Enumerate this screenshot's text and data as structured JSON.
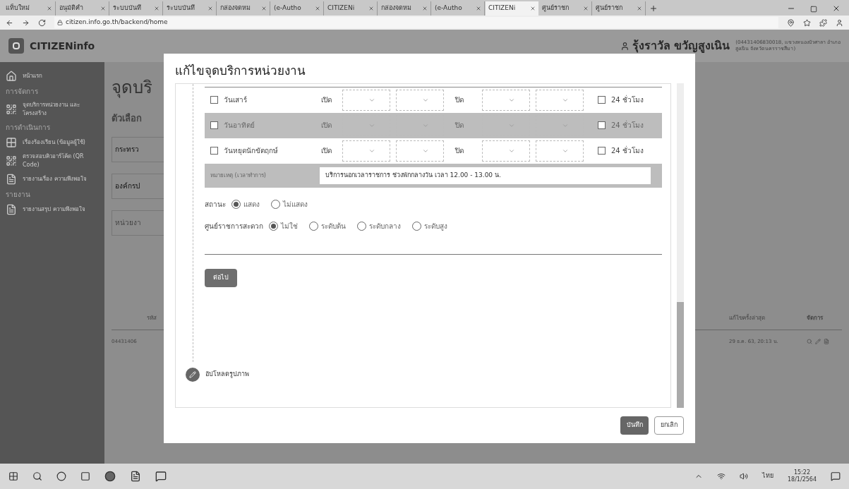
{
  "browser": {
    "tabs": [
      {
        "label": "แท็บใหม่",
        "selected": false
      },
      {
        "label": "อนุมัติคำ",
        "selected": false
      },
      {
        "label": "ระบบบันทึ",
        "selected": false
      },
      {
        "label": "ระบบบันทึ",
        "selected": false
      },
      {
        "label": "กล่องจดหม",
        "selected": false
      },
      {
        "label": "(e-Autho",
        "selected": false
      },
      {
        "label": "CITIZENi",
        "selected": false
      },
      {
        "label": "กล่องจดหม",
        "selected": false
      },
      {
        "label": "(e-Autho",
        "selected": false
      },
      {
        "label": "CITIZENi",
        "selected": true
      },
      {
        "label": "ศูนย์ราชก",
        "selected": false
      },
      {
        "label": "ศูนย์ราชก",
        "selected": false
      }
    ],
    "url": "citizen.info.go.th/backend/home"
  },
  "header": {
    "logo": "CITIZENinfo",
    "user_name": "รุ้งราวัล ขวัญสูงเนิน",
    "user_detail": [
      "(04431406830018, แขวงหนองบัวศาลา อำเภอ",
      "สูงเนิน จังหวัดนครราชสีมา)"
    ]
  },
  "sidebar": {
    "items": [
      {
        "kind": "link",
        "label": "หน้าแรก"
      },
      {
        "kind": "heading",
        "label": "การจัดการ"
      },
      {
        "kind": "link",
        "label": "จุดบริการหน่วยงาน และโครงสร้าง"
      },
      {
        "kind": "heading",
        "label": "การดำเนินการ"
      },
      {
        "kind": "link",
        "label": "เรื่องร้องเรียน (ข้อมูลผู้ใช้)"
      },
      {
        "kind": "link",
        "label": "ตรวจสอบคิวอาร์โค้ด (QR Code)"
      },
      {
        "kind": "link",
        "label": "รายงานเรื่อง ความพึงพอใจ"
      },
      {
        "kind": "heading",
        "label": "รายงาน"
      },
      {
        "kind": "link",
        "label": "รายงานสรุป ความพึงพอใจ"
      }
    ]
  },
  "page": {
    "title": "จุดบริ",
    "filter_title": "ตัวเลือก",
    "fields": [
      {
        "value": "กระทรว"
      },
      {
        "value": "องค์กรป"
      },
      {
        "placeholder": "หน่วยงา"
      }
    ],
    "table": {
      "columns": [
        "รหัส",
        "แก้ไขครั้งล่าสุด",
        "จัดการ"
      ],
      "rows": [
        [
          "04431406",
          "29 ธ.ค. 63, 20:13 น."
        ]
      ]
    }
  },
  "modal": {
    "title": "แก้ไขจุดบริการหน่วยงาน",
    "days": [
      {
        "day": "วันเสาร์",
        "open_label": "เปิด",
        "close_label": "ปิด",
        "checked": false,
        "all_day_label": "24 ชั่วโมง",
        "all_day_checked": false,
        "disabled": false
      },
      {
        "day": "วันอาทิตย์",
        "open_label": "เปิด",
        "close_label": "ปิด",
        "checked": false,
        "all_day_label": "24 ชั่วโมง",
        "all_day_checked": false,
        "disabled": true
      },
      {
        "day": "วันหยุดนักขัตฤกษ์",
        "open_label": "เปิด",
        "close_label": "ปิด",
        "checked": false,
        "all_day_label": "24 ชั่วโมง",
        "all_day_checked": false,
        "disabled": false
      }
    ],
    "note": {
      "label": "หมายเหตุ (เวลาทำการ)",
      "value": "บริการนอกเวลาราชการ ช่วงพักกลางวัน เวลา 12.00 - 13.00 น."
    },
    "radio_groups": [
      {
        "label": "สถานะ",
        "options": [
          {
            "label": "แสดง",
            "selected": true
          },
          {
            "label": "ไม่แสดง",
            "selected": false
          }
        ]
      },
      {
        "label": "ศูนย์ราชการสะดวก",
        "options": [
          {
            "label": "ไม่ใช่",
            "selected": true
          },
          {
            "label": "ระดับต้น",
            "selected": false
          },
          {
            "label": "ระดับกลาง",
            "selected": false
          },
          {
            "label": "ระดับสูง",
            "selected": false
          }
        ]
      }
    ],
    "next_button": "ต่อไป",
    "next_step": "อัปโหลดรูปภาพ",
    "save_button": "บันทึก",
    "cancel_button": "ยกเลิก"
  },
  "taskbar": {
    "language": "ไทย",
    "time": "15:22",
    "date": "18/1/2564"
  }
}
